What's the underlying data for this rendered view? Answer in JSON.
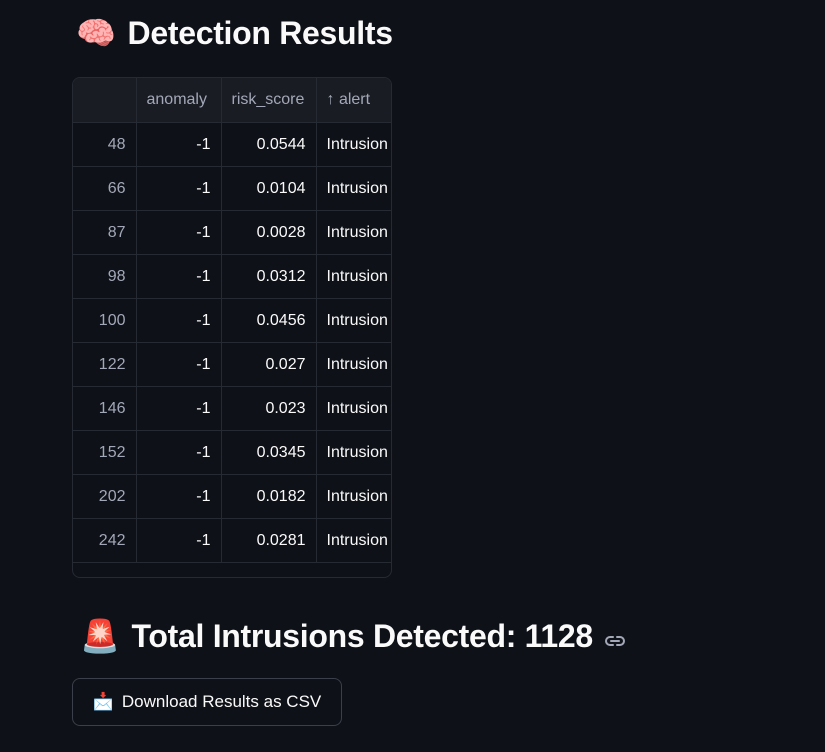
{
  "heading_detection": {
    "emoji": "🧠",
    "title": "Detection Results"
  },
  "table": {
    "columns": [
      "",
      "anomaly",
      "risk_score",
      "↑ alert"
    ],
    "rows": [
      {
        "index": "48",
        "anomaly": "-1",
        "risk_score": "0.0544",
        "alert": "Intrusion"
      },
      {
        "index": "66",
        "anomaly": "-1",
        "risk_score": "0.0104",
        "alert": "Intrusion"
      },
      {
        "index": "87",
        "anomaly": "-1",
        "risk_score": "0.0028",
        "alert": "Intrusion"
      },
      {
        "index": "98",
        "anomaly": "-1",
        "risk_score": "0.0312",
        "alert": "Intrusion"
      },
      {
        "index": "100",
        "anomaly": "-1",
        "risk_score": "0.0456",
        "alert": "Intrusion"
      },
      {
        "index": "122",
        "anomaly": "-1",
        "risk_score": "0.027",
        "alert": "Intrusion"
      },
      {
        "index": "146",
        "anomaly": "-1",
        "risk_score": "0.023",
        "alert": "Intrusion"
      },
      {
        "index": "152",
        "anomaly": "-1",
        "risk_score": "0.0345",
        "alert": "Intrusion"
      },
      {
        "index": "202",
        "anomaly": "-1",
        "risk_score": "0.0182",
        "alert": "Intrusion"
      },
      {
        "index": "242",
        "anomaly": "-1",
        "risk_score": "0.0281",
        "alert": "Intrusion"
      }
    ]
  },
  "heading_total": {
    "emoji": "🚨",
    "title": "Total Intrusions Detected: 1128",
    "link_icon": "link-icon"
  },
  "download": {
    "icon": "📩",
    "label": "Download Results as CSV"
  },
  "colors": {
    "background": "#0e1117",
    "table_header": "#1a1c24",
    "border": "#262a33",
    "text": "#fafafa",
    "muted_text": "#a3a8b8"
  }
}
